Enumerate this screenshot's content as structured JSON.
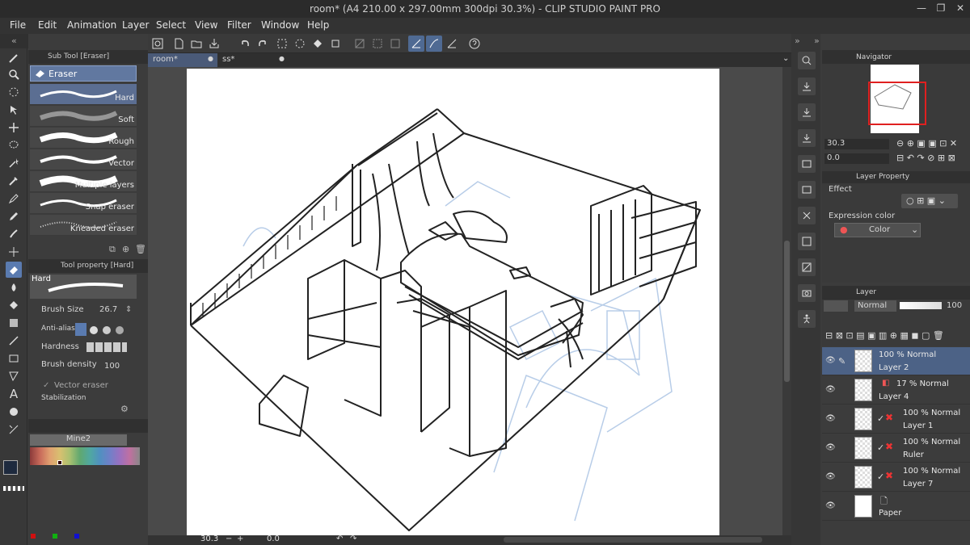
{
  "window": {
    "title": "room* (A4 210.00 x 297.00mm 300dpi 30.3%) - CLIP STUDIO PAINT PRO",
    "minimize": "—",
    "maximize": "❐",
    "close": "✕"
  },
  "menu": [
    "File",
    "Edit",
    "Animation",
    "Layer",
    "Select",
    "View",
    "Filter",
    "Window",
    "Help"
  ],
  "tabs": [
    {
      "label": "room*",
      "close": "●"
    },
    {
      "label": "ss*",
      "close": "●"
    }
  ],
  "subtool": {
    "title": "Sub Tool [Eraser]",
    "group": "Eraser",
    "brushes": [
      "Hard",
      "Soft",
      "Rough",
      "Vector",
      "Multiple layers",
      "Snap eraser",
      "Kneaded eraser"
    ]
  },
  "toolprop": {
    "title": "Tool property [Hard]",
    "preset": "Hard",
    "brush_size_label": "Brush Size",
    "brush_size_value": "26.7",
    "antialias_label": "Anti-aliasing",
    "hardness_label": "Hardness",
    "brush_density_label": "Brush density",
    "brush_density_value": "100",
    "vector_eraser_label": "Vector eraser",
    "stabilization_label": "Stabilization"
  },
  "colorset": {
    "name": "Mine2"
  },
  "colors": {
    "main": "#1e2a3e",
    "sub": "#e03a3a",
    "accent": "#5a7bb0",
    "red": "#d01010",
    "green": "#10b010",
    "blue": "#1010d0"
  },
  "navigator": {
    "title": "Navigator",
    "zoom": "30.3",
    "rotation": "0.0"
  },
  "layer_property": {
    "title": "Layer Property",
    "effect_label": "Effect",
    "expression_label": "Expression color",
    "expression_value": "Color"
  },
  "layers_panel": {
    "title": "Layer",
    "blend": "Normal",
    "opacity": "100"
  },
  "layers": [
    {
      "mode": "100 % Normal",
      "name": "Layer 2"
    },
    {
      "mode": "17 % Normal",
      "name": "Layer 4"
    },
    {
      "mode": "100 % Normal",
      "name": "Layer 1"
    },
    {
      "mode": "100 % Normal",
      "name": "Ruler"
    },
    {
      "mode": "100 % Normal",
      "name": "Layer 7"
    },
    {
      "mode": "",
      "name": "Paper"
    }
  ],
  "status": {
    "zoom": "30.3",
    "rotation": "0.0"
  }
}
